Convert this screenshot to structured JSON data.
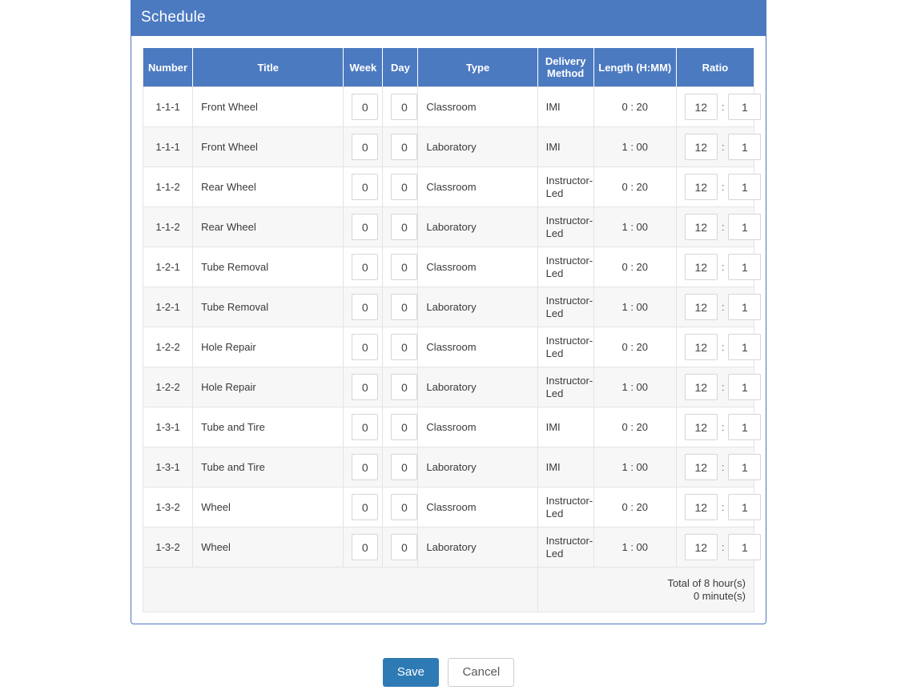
{
  "panel": {
    "title": "Schedule"
  },
  "table": {
    "headers": {
      "number": "Number",
      "title": "Title",
      "week": "Week",
      "day": "Day",
      "type": "Type",
      "delivery_method": "Delivery Method",
      "length": "Length (H:MM)",
      "ratio": "Ratio"
    },
    "ratio_separator": ":",
    "rows": [
      {
        "number": "1-1-1",
        "title": "Front Wheel",
        "week": "0",
        "day": "0",
        "type": "Classroom",
        "delivery_method": "IMI",
        "length": "0 : 20",
        "ratio_left": "12",
        "ratio_right": "1"
      },
      {
        "number": "1-1-1",
        "title": "Front Wheel",
        "week": "0",
        "day": "0",
        "type": "Laboratory",
        "delivery_method": "IMI",
        "length": "1 : 00",
        "ratio_left": "12",
        "ratio_right": "1"
      },
      {
        "number": "1-1-2",
        "title": "Rear Wheel",
        "week": "0",
        "day": "0",
        "type": "Classroom",
        "delivery_method": "Instructor-Led",
        "length": "0 : 20",
        "ratio_left": "12",
        "ratio_right": "1"
      },
      {
        "number": "1-1-2",
        "title": "Rear Wheel",
        "week": "0",
        "day": "0",
        "type": "Laboratory",
        "delivery_method": "Instructor-Led",
        "length": "1 : 00",
        "ratio_left": "12",
        "ratio_right": "1"
      },
      {
        "number": "1-2-1",
        "title": "Tube Removal",
        "week": "0",
        "day": "0",
        "type": "Classroom",
        "delivery_method": "Instructor-Led",
        "length": "0 : 20",
        "ratio_left": "12",
        "ratio_right": "1"
      },
      {
        "number": "1-2-1",
        "title": "Tube Removal",
        "week": "0",
        "day": "0",
        "type": "Laboratory",
        "delivery_method": "Instructor-Led",
        "length": "1 : 00",
        "ratio_left": "12",
        "ratio_right": "1"
      },
      {
        "number": "1-2-2",
        "title": "Hole Repair",
        "week": "0",
        "day": "0",
        "type": "Classroom",
        "delivery_method": "Instructor-Led",
        "length": "0 : 20",
        "ratio_left": "12",
        "ratio_right": "1"
      },
      {
        "number": "1-2-2",
        "title": "Hole Repair",
        "week": "0",
        "day": "0",
        "type": "Laboratory",
        "delivery_method": "Instructor-Led",
        "length": "1 : 00",
        "ratio_left": "12",
        "ratio_right": "1"
      },
      {
        "number": "1-3-1",
        "title": "Tube and Tire",
        "week": "0",
        "day": "0",
        "type": "Classroom",
        "delivery_method": "IMI",
        "length": "0 : 20",
        "ratio_left": "12",
        "ratio_right": "1"
      },
      {
        "number": "1-3-1",
        "title": "Tube and Tire",
        "week": "0",
        "day": "0",
        "type": "Laboratory",
        "delivery_method": "IMI",
        "length": "1 : 00",
        "ratio_left": "12",
        "ratio_right": "1"
      },
      {
        "number": "1-3-2",
        "title": "Wheel",
        "week": "0",
        "day": "0",
        "type": "Classroom",
        "delivery_method": "Instructor-Led",
        "length": "0 : 20",
        "ratio_left": "12",
        "ratio_right": "1"
      },
      {
        "number": "1-3-2",
        "title": "Wheel",
        "week": "0",
        "day": "0",
        "type": "Laboratory",
        "delivery_method": "Instructor-Led",
        "length": "1 : 00",
        "ratio_left": "12",
        "ratio_right": "1"
      }
    ],
    "total": {
      "hours_line": "Total of 8 hour(s)",
      "minutes_line": "0 minute(s)"
    }
  },
  "actions": {
    "save_label": "Save",
    "cancel_label": "Cancel"
  },
  "colors": {
    "header_blue": "#4c7ac0",
    "panel_border": "#4a77bf",
    "save_button": "#2e7ab5",
    "row_alt": "#f7f7f7",
    "text": "#333333"
  }
}
